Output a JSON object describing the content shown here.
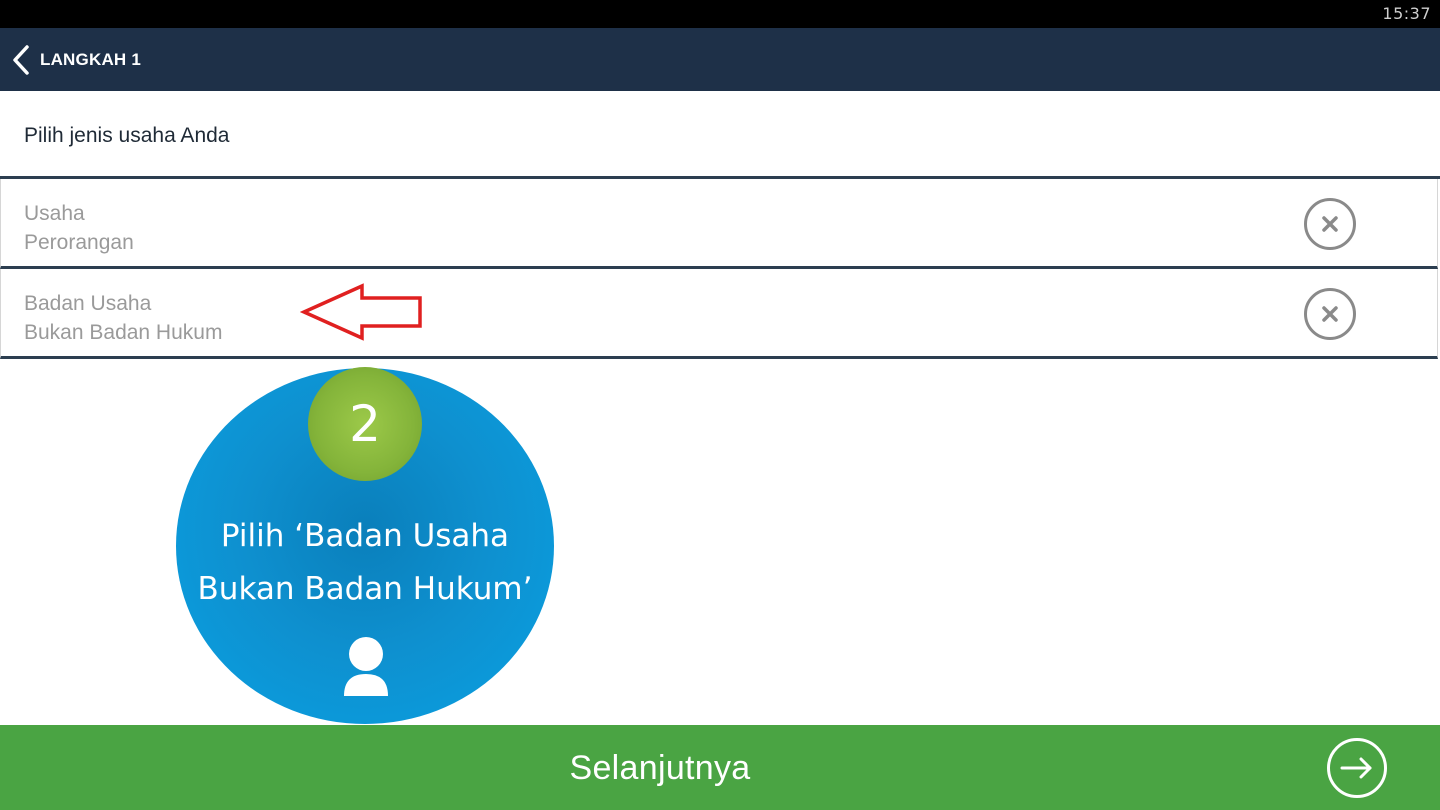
{
  "status_bar": {
    "time": "15:37"
  },
  "app_bar": {
    "title": "LANGKAH 1",
    "back_icon": "chevron-left-icon"
  },
  "question": {
    "text": "Pilih jenis usaha Anda"
  },
  "options": [
    {
      "line1": "Usaha",
      "line2": "Perorangan",
      "icon": "close-circle-icon"
    },
    {
      "line1": "Badan Usaha",
      "line2": "Bukan Badan Hukum",
      "icon": "close-circle-icon"
    }
  ],
  "callout": {
    "step_number": "2",
    "line1": "Pilih ‘Badan Usaha",
    "line2": "Bukan Badan Hukum’",
    "icon": "person-icon"
  },
  "next_button": {
    "label": "Selanjutnya",
    "icon": "arrow-right-circle-icon"
  },
  "colors": {
    "app_bar": "#1e3048",
    "next_bar": "#4aa443",
    "callout_blue": "#0aa1e3",
    "badge_green": "#84b43a",
    "arrow_red": "#e02020"
  }
}
